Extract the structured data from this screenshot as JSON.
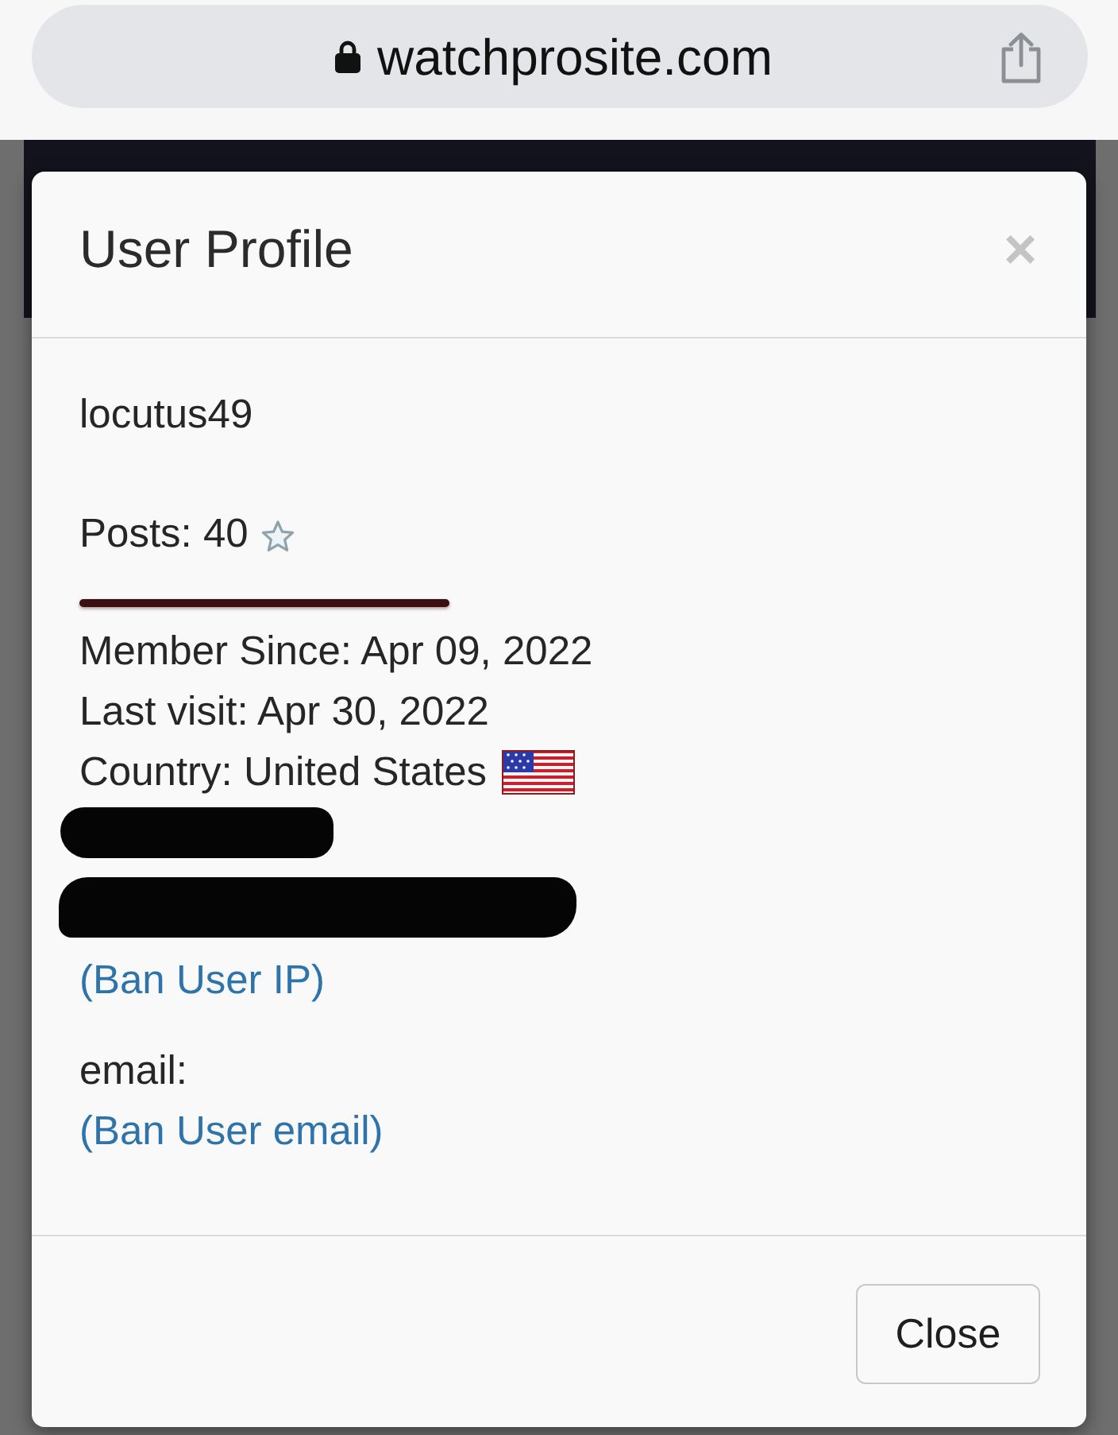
{
  "browser": {
    "url": "watchprosite.com"
  },
  "modal": {
    "title": "User Profile",
    "close_glyph": "×",
    "lines": [
      {
        "kind": "text",
        "text": "locutus49"
      },
      {
        "kind": "posts",
        "text": "Posts: 40"
      },
      {
        "kind": "rule"
      },
      {
        "kind": "text",
        "text": "Member Since: Apr 09, 2022"
      },
      {
        "kind": "text",
        "text": "Last visit: Apr 30, 2022"
      },
      {
        "kind": "country",
        "text": "Country: United States"
      },
      {
        "kind": "redacted"
      },
      {
        "kind": "redacted"
      },
      {
        "kind": "link",
        "text": "(Ban User IP)"
      },
      {
        "kind": "text",
        "text": "email:"
      },
      {
        "kind": "link",
        "text": "(Ban User email)"
      }
    ],
    "buttons": [
      {
        "label": "Close"
      }
    ]
  }
}
